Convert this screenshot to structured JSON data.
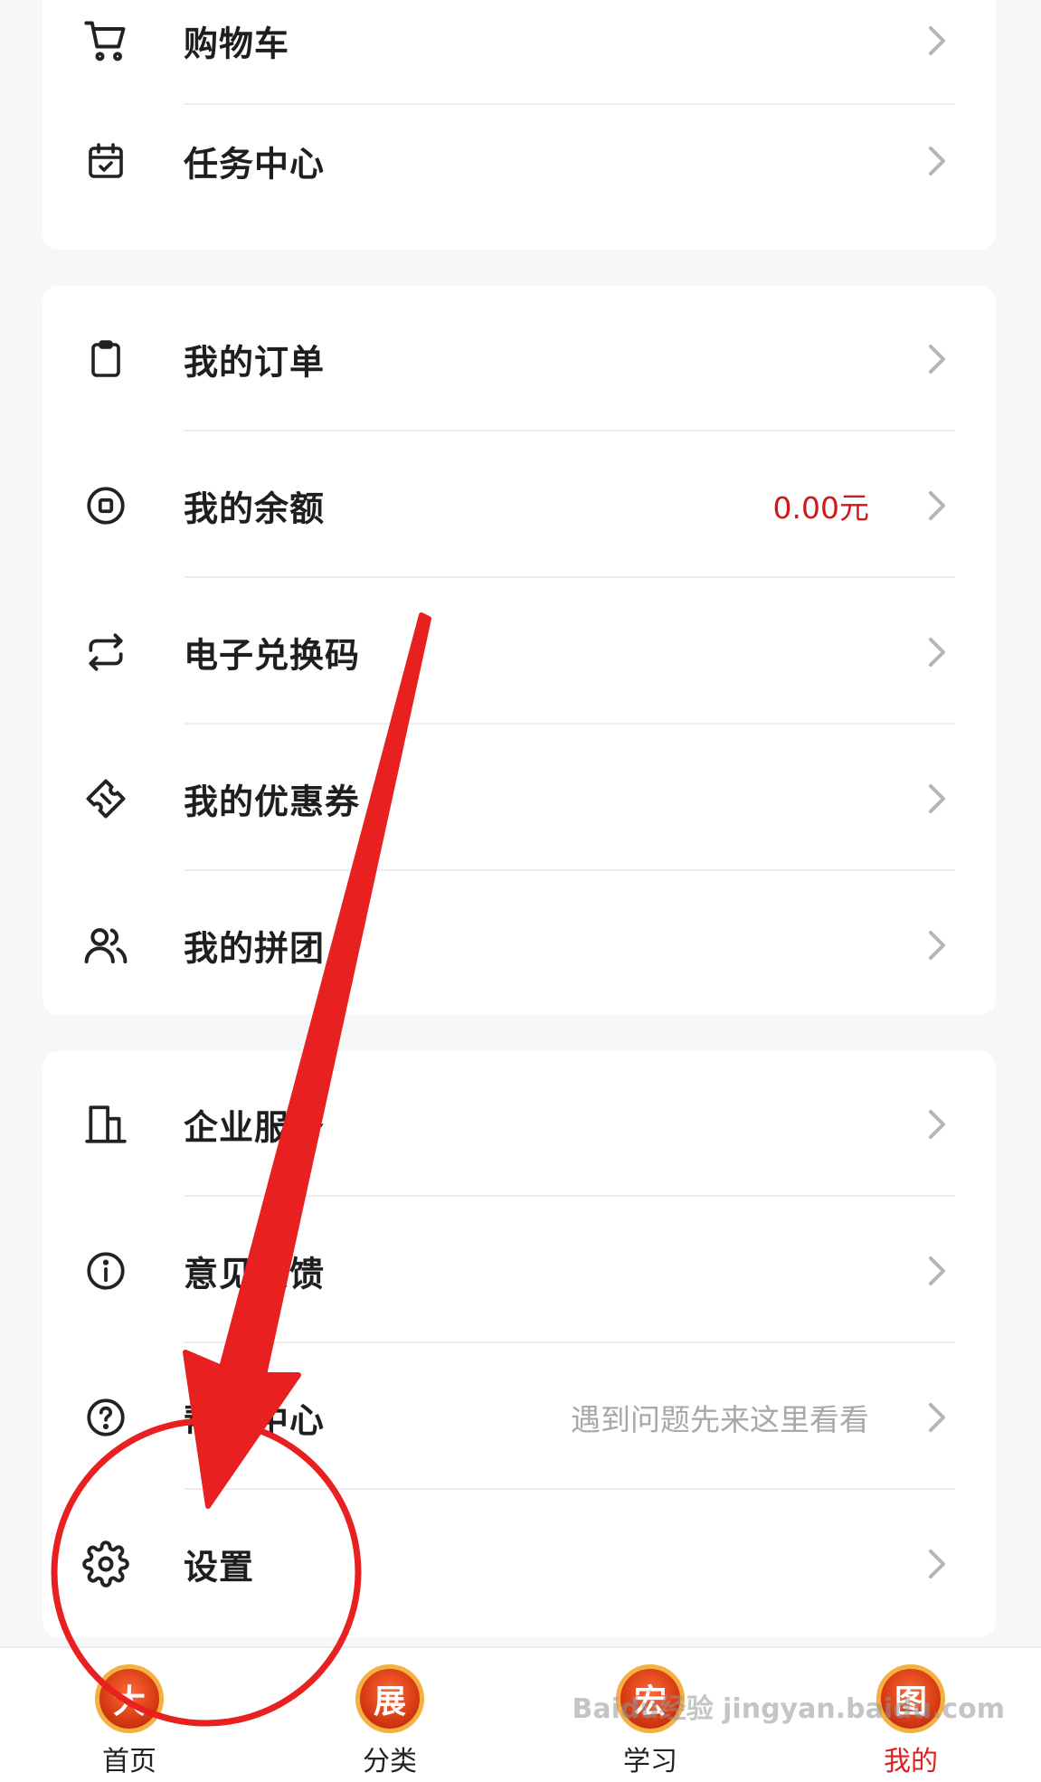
{
  "colors": {
    "accent_red": "#e02020",
    "balance_red": "#d01818",
    "hint_gray": "#a8a8a8",
    "chevron_gray": "#b5b5b5"
  },
  "group1": [
    {
      "label": "购物车",
      "icon": "cart-icon"
    },
    {
      "label": "任务中心",
      "icon": "calendar-check-icon"
    }
  ],
  "group2": [
    {
      "label": "我的订单",
      "icon": "clipboard-icon"
    },
    {
      "label": "我的余额",
      "icon": "coin-icon",
      "extra": "0.00元"
    },
    {
      "label": "电子兑换码",
      "icon": "exchange-icon"
    },
    {
      "label": "我的优惠券",
      "icon": "ticket-icon"
    },
    {
      "label": "我的拼团",
      "icon": "users-icon"
    }
  ],
  "group3": [
    {
      "label": "企业服务",
      "icon": "building-icon"
    },
    {
      "label": "意见反馈",
      "icon": "info-icon"
    },
    {
      "label": "帮助中心",
      "icon": "help-icon",
      "extra": "遇到问题先来这里看看"
    },
    {
      "label": "设置",
      "icon": "gear-icon"
    }
  ],
  "tabbar": [
    {
      "label": "首页",
      "badge": "大",
      "active": false
    },
    {
      "label": "分类",
      "badge": "展",
      "active": false
    },
    {
      "label": "学习",
      "badge": "宏",
      "active": false
    },
    {
      "label": "我的",
      "badge": "图",
      "active": true
    }
  ],
  "watermark": "Baidu经验 jingyan.baidu.com"
}
